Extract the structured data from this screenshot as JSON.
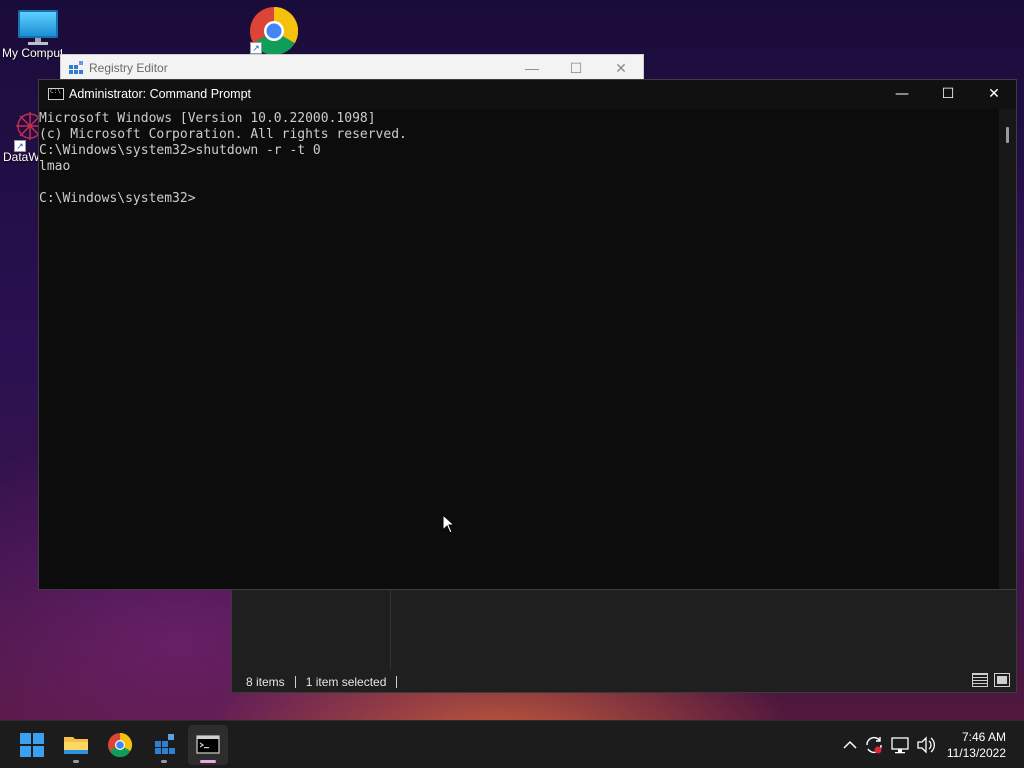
{
  "desktop": {
    "icons": [
      {
        "label": "My Computer",
        "icon": "monitor-icon"
      },
      {
        "label": "",
        "icon": "chrome-icon"
      },
      {
        "label": "DataWiper",
        "icon": "datawiper-icon"
      }
    ]
  },
  "registry_window": {
    "title": "Registry Editor",
    "minimize": "—",
    "maximize": "☐",
    "close": "✕"
  },
  "explorer_window": {
    "status_items": "8 items",
    "status_selected": "1 item selected"
  },
  "cmd_window": {
    "title": "Administrator: Command Prompt",
    "minimize": "—",
    "maximize": "☐",
    "close": "✕",
    "lines": [
      "Microsoft Windows [Version 10.0.22000.1098]",
      "(c) Microsoft Corporation. All rights reserved.",
      "C:\\Windows\\system32>shutdown -r -t 0",
      "lmao",
      "",
      "C:\\Windows\\system32>"
    ]
  },
  "taskbar": {
    "apps": [
      {
        "name": "start",
        "icon": "windows-logo-icon"
      },
      {
        "name": "file-explorer",
        "icon": "folder-icon"
      },
      {
        "name": "chrome",
        "icon": "chrome-icon"
      },
      {
        "name": "registry-editor",
        "icon": "registry-icon"
      },
      {
        "name": "command-prompt",
        "icon": "terminal-icon"
      }
    ],
    "tray_icons": [
      "chevron-up-icon",
      "sync-icon",
      "network-icon",
      "volume-icon"
    ],
    "time": "7:46 AM",
    "date": "11/13/2022"
  },
  "colors": {
    "cmd_background": "#0c0c0c",
    "cmd_text": "#cccccc",
    "taskbar": "#1c1c1c",
    "accent_indicator": "#e8a6e8"
  }
}
